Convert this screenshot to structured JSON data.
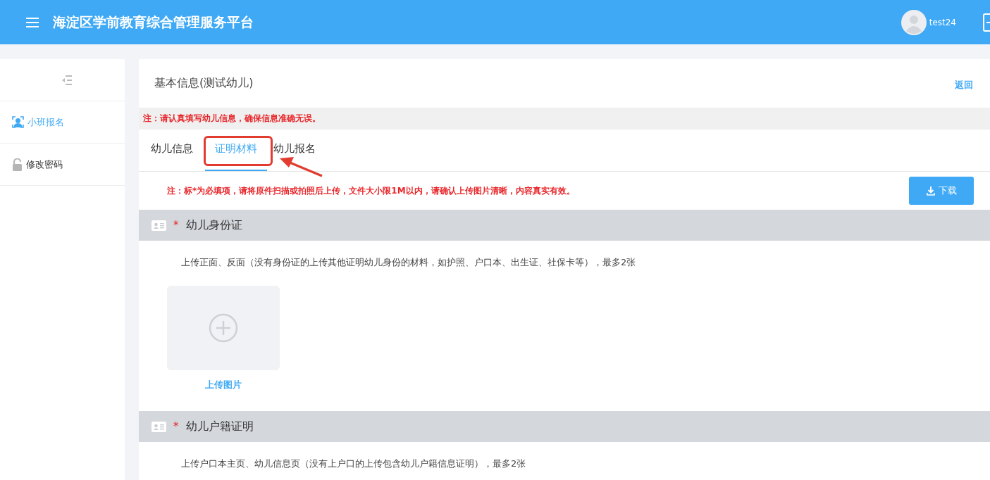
{
  "header": {
    "title": "海淀区学前教育综合管理服务平台",
    "user": "test24"
  },
  "sidebar": {
    "items": [
      {
        "label": "小班报名",
        "kind": "person",
        "selected": true
      },
      {
        "label": "修改密码",
        "kind": "lock",
        "selected": false
      }
    ]
  },
  "page": {
    "title": "基本信息(测试幼儿)",
    "back_link": "返回",
    "notice": "注：请认真填写幼儿信息，确保信息准确无误。"
  },
  "tabs": [
    {
      "label": "幼儿信息",
      "selected": false
    },
    {
      "label": "证明材料",
      "selected": true
    },
    {
      "label": "幼儿报名",
      "selected": false
    }
  ],
  "upload_notice": "注：标*为必填项，请将原件扫描或拍照后上传，文件大小限1M以内，请确认上传图片清晰，内容真实有效。",
  "download_button": "下载",
  "sections": [
    {
      "title": "幼儿身份证",
      "required_mark": "*",
      "description": "上传正面、反面（没有身份证的上传其他证明幼儿身份的材料，如护照、户口本、出生证、社保卡等），最多2张",
      "upload_label": "上传图片"
    },
    {
      "title": "幼儿户籍证明",
      "required_mark": "*",
      "description": "上传户口本主页、幼儿信息页（没有上户口的上传包含幼儿户籍信息证明），最多2张"
    }
  ]
}
